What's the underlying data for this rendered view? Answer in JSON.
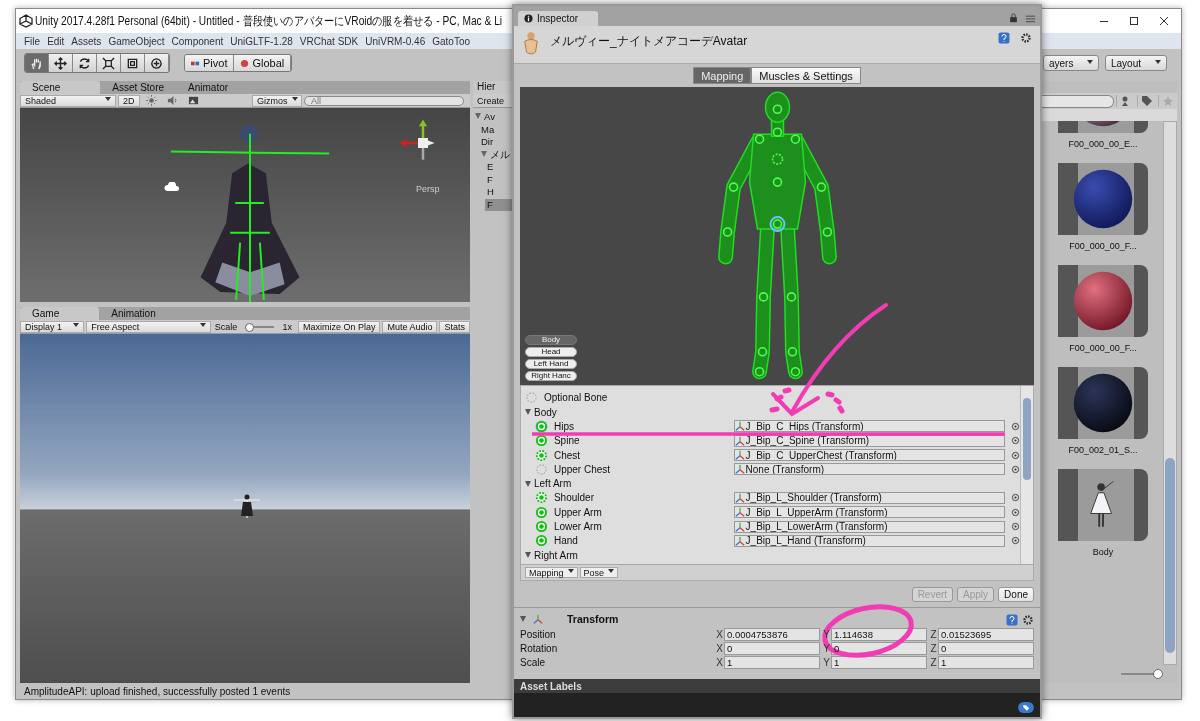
{
  "window": {
    "title": "Unity 2017.4.28f1 Personal (64bit) - Untitled - 普段使いのアバターにVRoidの服を着せる - PC, Mac & Li"
  },
  "menu": [
    "File",
    "Edit",
    "Assets",
    "GameObject",
    "Component",
    "UniGLTF-1.28",
    "VRChat SDK",
    "UniVRM-0.46",
    "GatoToo"
  ],
  "toolbar": {
    "tools": [
      {
        "kind": "hand",
        "selected": true
      },
      {
        "kind": "move",
        "selected": false
      },
      {
        "kind": "rotate",
        "selected": false
      },
      {
        "kind": "scale",
        "selected": false
      },
      {
        "kind": "rect",
        "selected": false
      },
      {
        "kind": "transform",
        "selected": false
      }
    ],
    "pivot": "Pivot",
    "global": "Global",
    "layers": "ayers",
    "layout": "Layout"
  },
  "scene_panel": {
    "tabs": [
      {
        "label": "Scene",
        "selected": true
      },
      {
        "label": "Asset Store",
        "selected": false
      },
      {
        "label": "Animator",
        "selected": false
      }
    ],
    "shading": "Shaded",
    "mode_2d": "2D",
    "gizmos": "Gizmos",
    "search": {
      "placeholder": "All"
    },
    "view_label": "Persp"
  },
  "game_panel": {
    "tabs": [
      {
        "label": "Game",
        "selected": true
      },
      {
        "label": "Animation",
        "selected": false
      }
    ],
    "display": "Display 1",
    "aspect": "Free Aspect",
    "scale_label": "Scale",
    "scale_slider": {
      "level": 0
    },
    "scale_value": "1x",
    "buttons": [
      "Maximize On Play",
      "Mute Audio",
      "Stats"
    ]
  },
  "hierarchy": {
    "tab": "Hier",
    "create": "Create",
    "items": [
      {
        "label": "Av",
        "selected": false,
        "expanded": true,
        "children": [
          {
            "label": "Ma",
            "selected": false
          },
          {
            "label": "Dir",
            "selected": false
          },
          {
            "label": "メル",
            "selected": false,
            "expanded": true,
            "children": [
              {
                "label": "E",
                "selected": false
              },
              {
                "label": "F",
                "selected": false
              },
              {
                "label": "H",
                "selected": false
              },
              {
                "label": "F",
                "selected": true
              }
            ]
          }
        ]
      }
    ]
  },
  "project": {
    "size_slider": {
      "level": 1
    },
    "items": [
      {
        "label": "F00_000_00_E...",
        "kind": "material"
      },
      {
        "label": "F00_000_00_F...",
        "kind": "material"
      },
      {
        "label": "F00_000_00_F...",
        "kind": "material"
      },
      {
        "label": "F00_002_01_S...",
        "kind": "material"
      },
      {
        "label": "Body",
        "kind": "model"
      }
    ]
  },
  "inspector": {
    "tab": "Inspector",
    "object_name": "メルヴィー_ナイトメアコーデAvatar",
    "modes": [
      {
        "label": "Mapping",
        "selected": true
      },
      {
        "label": "Muscles & Settings",
        "selected": false
      }
    ],
    "view_buttons": [
      {
        "label": "Body",
        "selected": true
      },
      {
        "label": "Head",
        "selected": false
      },
      {
        "label": "Left Hand",
        "selected": false
      },
      {
        "label": "Right Hanc",
        "selected": false
      }
    ],
    "optional_bone": "Optional Bone",
    "groups": [
      {
        "name": "Body",
        "expanded": true,
        "bones": [
          {
            "name": "Hips",
            "kind": "required",
            "selected": true,
            "value": "J_Bip_C_Hips (Transform)"
          },
          {
            "name": "Spine",
            "kind": "required",
            "selected": false,
            "value": "J_Bip_C_Spine (Transform)"
          },
          {
            "name": "Chest",
            "kind": "optional",
            "selected": false,
            "value": "J_Bip_C_UpperChest (Transform)"
          },
          {
            "name": "Upper Chest",
            "kind": "missing",
            "selected": false,
            "value": "None (Transform)"
          }
        ]
      },
      {
        "name": "Left Arm",
        "expanded": true,
        "bones": [
          {
            "name": "Shoulder",
            "kind": "optional",
            "selected": false,
            "value": "J_Bip_L_Shoulder (Transform)"
          },
          {
            "name": "Upper Arm",
            "kind": "required",
            "selected": false,
            "value": "J_Bip_L_UpperArm (Transform)"
          },
          {
            "name": "Lower Arm",
            "kind": "required",
            "selected": false,
            "value": "J_Bip_L_LowerArm (Transform)"
          },
          {
            "name": "Hand",
            "kind": "required",
            "selected": false,
            "value": "J_Bip_L_Hand (Transform)"
          }
        ]
      },
      {
        "name": "Right Arm",
        "expanded": true
      }
    ],
    "list_menus": [
      "Mapping",
      "Pose"
    ],
    "actions": [
      {
        "label": "Revert",
        "disabled": true
      },
      {
        "label": "Apply",
        "disabled": true
      },
      {
        "label": "Done",
        "disabled": false
      }
    ],
    "transform": {
      "title": "Transform",
      "expanded": true,
      "rows": [
        {
          "label": "Position",
          "values": [
            {
              "axis": "X",
              "value": "0.0004753876"
            },
            {
              "axis": "Y",
              "value": "1.114638"
            },
            {
              "axis": "Z",
              "value": "0.01523695"
            }
          ]
        },
        {
          "label": "Rotation",
          "values": [
            {
              "axis": "X",
              "value": "0"
            },
            {
              "axis": "Y",
              "value": "0"
            },
            {
              "axis": "Z",
              "value": "0"
            }
          ]
        },
        {
          "label": "Scale",
          "values": [
            {
              "axis": "X",
              "value": "1"
            },
            {
              "axis": "Y",
              "value": "1"
            },
            {
              "axis": "Z",
              "value": "1"
            }
          ]
        }
      ]
    },
    "asset_labels": "Asset Labels"
  },
  "status_bar": "AmplitudeAPI: upload finished, successfully posted 1 events"
}
